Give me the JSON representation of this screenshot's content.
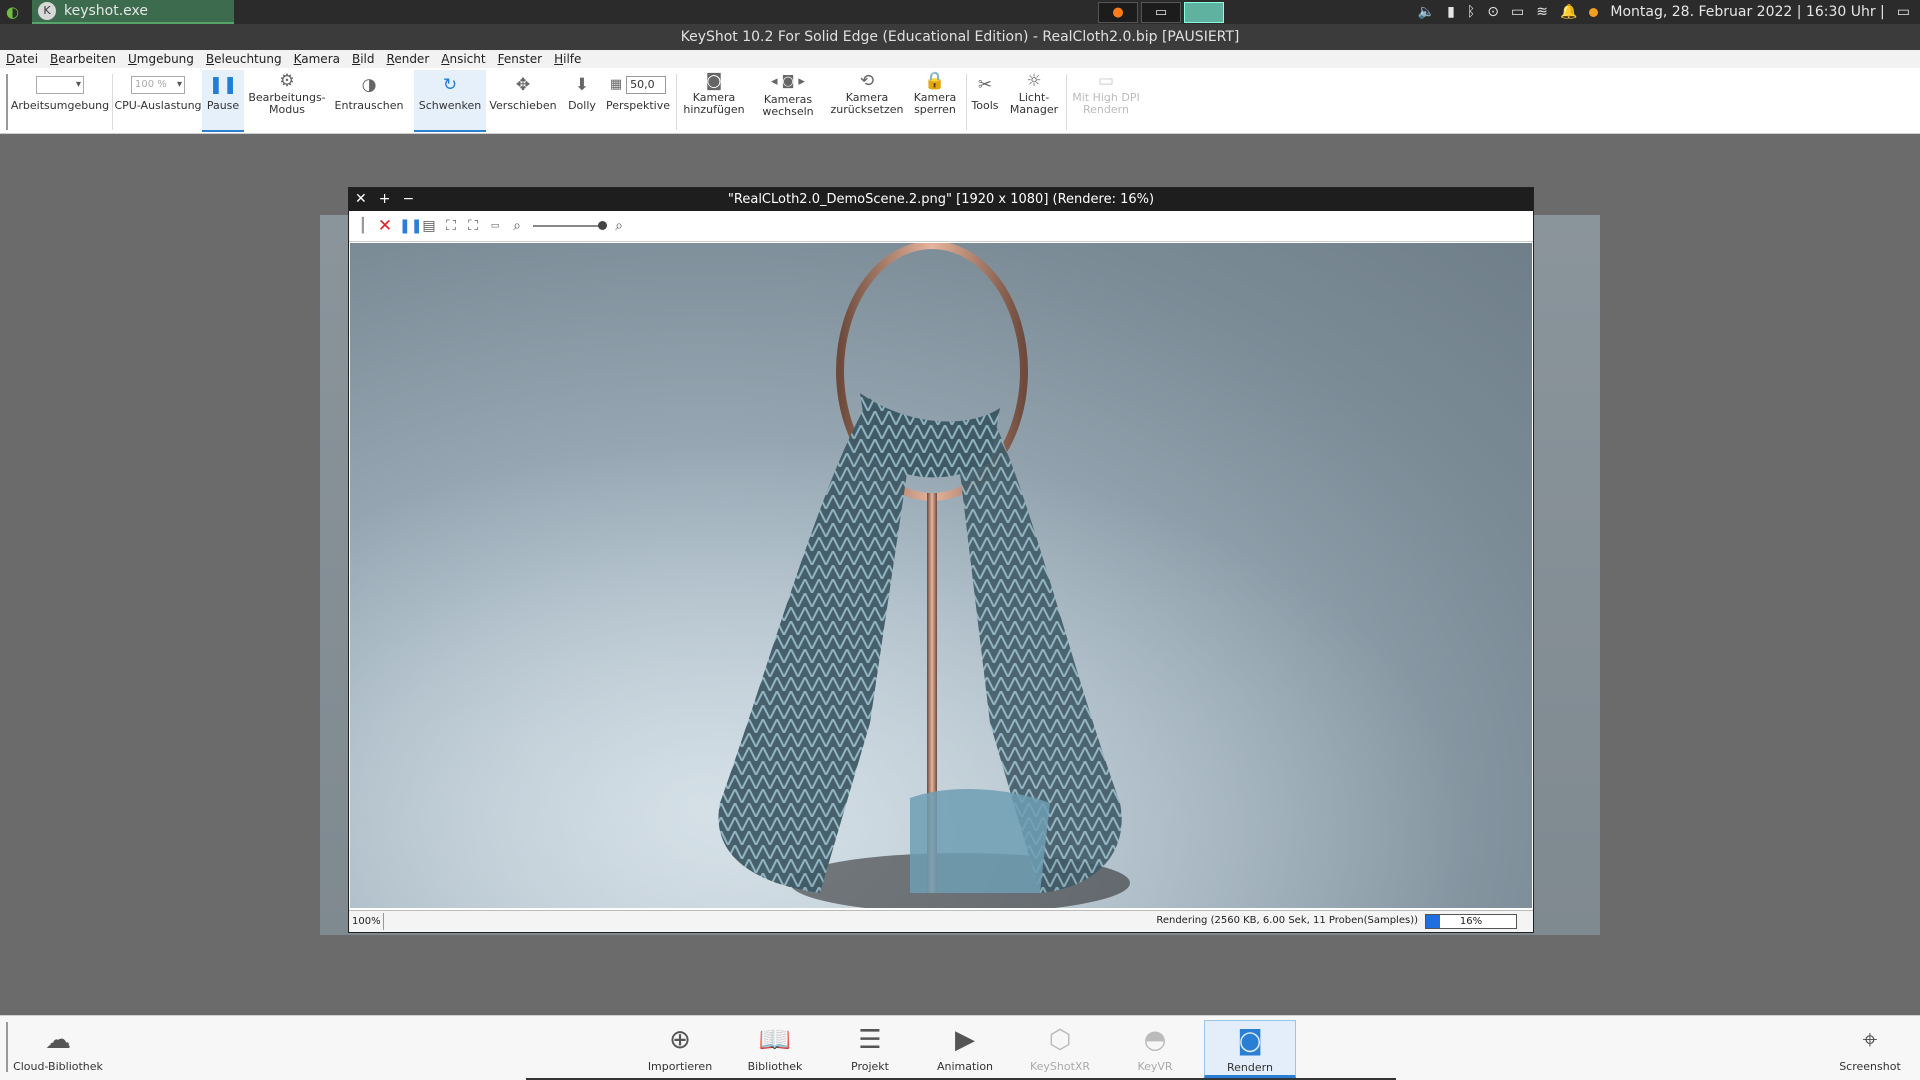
{
  "taskbar": {
    "task_label": "keyshot.exe",
    "datetime": "Montag, 28. Februar 2022 | 16:30 Uhr |"
  },
  "window": {
    "title": "KeyShot 10.2 For Solid Edge (Educational Edition) - RealCloth2.0.bip [PAUSIERT]"
  },
  "menu": [
    "Datei",
    "Bearbeiten",
    "Umgebung",
    "Beleuchtung",
    "Kamera",
    "Bild",
    "Render",
    "Ansicht",
    "Fenster",
    "Hilfe"
  ],
  "toolbar": {
    "arbeitsumgebung": "Arbeitsumgebung",
    "cpu_value": "100 %",
    "cpu_label": "CPU-Auslastung",
    "pause": "Pause",
    "bearbeitungs_line1": "Bearbeitungs-",
    "bearbeitungs_line2": "Modus",
    "entrauschen": "Entrauschen",
    "schwenken": "Schwenken",
    "verschieben": "Verschieben",
    "dolly": "Dolly",
    "perspektive_value": "50,0",
    "perspektive": "Perspektive",
    "kamera_hinzu_1": "Kamera",
    "kamera_hinzu_2": "hinzufügen",
    "kameras_wechseln_1": "Kameras",
    "kameras_wechseln_2": "wechseln",
    "kamera_zurueck_1": "Kamera",
    "kamera_zurueck_2": "zurücksetzen",
    "kamera_sperren_1": "Kamera",
    "kamera_sperren_2": "sperren",
    "tools": "Tools",
    "licht_1": "Licht-",
    "licht_2": "Manager",
    "hidpi_1": "Mit High DPI",
    "hidpi_2": "Rendern"
  },
  "render_window": {
    "title": "\"RealCLoth2.0_DemoScene.2.png\" [1920 x 1080] (Rendere: 16%)",
    "zoom": "100%",
    "status": "Rendering (2560 KB, 6.00 Sek, 11 Proben(Samples))",
    "progress_label": "16%",
    "progress": 0.16
  },
  "bottombar": {
    "cloud": "Cloud-Bibliothek",
    "importieren": "Importieren",
    "bibliothek": "Bibliothek",
    "projekt": "Projekt",
    "animation": "Animation",
    "keyshotxr": "KeyShotXR",
    "keyvr": "KeyVR",
    "rendern": "Rendern",
    "screenshot": "Screenshot"
  },
  "colors": {
    "accent": "#2a7fd5",
    "progress_fill": "#1f6fe0"
  }
}
